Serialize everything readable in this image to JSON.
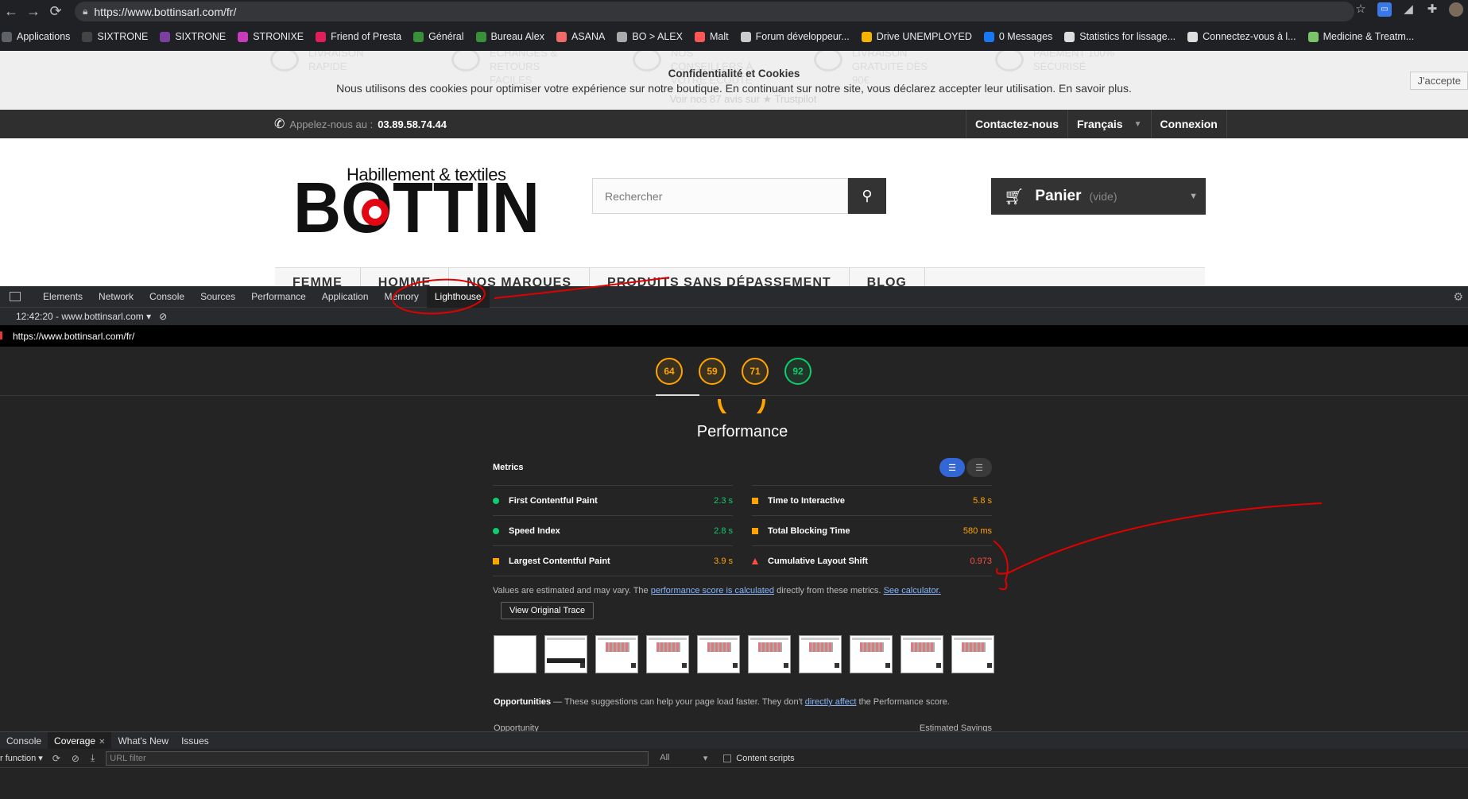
{
  "browser": {
    "url": "https://www.bottinsarl.com/fr/",
    "bookmarks": [
      {
        "label": "Applications",
        "color": "#5f6368"
      },
      {
        "label": "SIXTRONE",
        "color": "#444"
      },
      {
        "label": "SIXTRONE",
        "color": "#7b3fa0"
      },
      {
        "label": "STRONIXE",
        "color": "#c83cb9"
      },
      {
        "label": "Friend of Presta",
        "color": "#e01e5a"
      },
      {
        "label": "Général",
        "color": "#3a8f3a"
      },
      {
        "label": "Bureau Alex",
        "color": "#3a8f3a"
      },
      {
        "label": "ASANA",
        "color": "#f06a6a"
      },
      {
        "label": "BO > ALEX",
        "color": "#aaa"
      },
      {
        "label": "Malt",
        "color": "#fc5757"
      },
      {
        "label": "Forum développeur...",
        "color": "#ccc"
      },
      {
        "label": "Drive UNEMPLOYED",
        "color": "#f4b400"
      },
      {
        "label": "0 Messages",
        "color": "#1877f2"
      },
      {
        "label": "Statistics for lissage...",
        "color": "#ddd"
      },
      {
        "label": "Connectez-vous à l...",
        "color": "#ddd"
      },
      {
        "label": "Medicine & Treatm...",
        "color": "#7cc46a"
      }
    ]
  },
  "site": {
    "reassurance": [
      {
        "label": "LIVRAISON RAPIDE"
      },
      {
        "label": "ÉCHANGES & RETOURS FACILES"
      },
      {
        "label": "NOS CONSEILLERS À VOTRE ÉCOUTE"
      },
      {
        "label": "LIVRAISON GRATUITE DÈS 90€"
      },
      {
        "label": "PAIEMENT 100% SÉCURISÉ"
      }
    ],
    "cookie": {
      "title": "Confidentialité et Cookies",
      "text": "Nous utilisons des cookies pour optimiser votre expérience sur notre boutique. En continuant sur notre site, vous déclarez accepter leur utilisation. En savoir plus.",
      "accept": "J'accepte",
      "trustpilot": "Voir nos 87 avis sur  ★ Trustpilot"
    },
    "phone_label": "Appelez-nous au :",
    "phone_number": "03.89.58.74.44",
    "topnav": {
      "contact": "Contactez-nous",
      "language": "Français",
      "login": "Connexion"
    },
    "logo": {
      "tagline": "Habillement & textiles",
      "name": "BOTTIN"
    },
    "search_placeholder": "Rechercher",
    "cart": {
      "label": "Panier",
      "state": "(vide)"
    },
    "menu": [
      "FEMME",
      "HOMME",
      "NOS MARQUES",
      "PRODUITS SANS DÉPASSEMENT",
      "BLOG"
    ]
  },
  "devtools": {
    "tabs": [
      "Elements",
      "Network",
      "Console",
      "Sources",
      "Performance",
      "Application",
      "Memory",
      "Lighthouse"
    ],
    "active_tab": "Lighthouse",
    "report_select": "12:42:20 - www.bottinsarl.com",
    "report_url": "https://www.bottinsarl.com/fr/",
    "gauges": [
      {
        "score": "64",
        "color": "orange"
      },
      {
        "score": "59",
        "color": "orange"
      },
      {
        "score": "71",
        "color": "orange"
      },
      {
        "score": "92",
        "color": "green"
      }
    ],
    "category_title": "Performance",
    "metrics_title": "Metrics",
    "metrics": [
      {
        "name": "First Contentful Paint",
        "value": "2.3 s",
        "status": "green"
      },
      {
        "name": "Time to Interactive",
        "value": "5.8 s",
        "status": "orange"
      },
      {
        "name": "Speed Index",
        "value": "2.8 s",
        "status": "green"
      },
      {
        "name": "Total Blocking Time",
        "value": "580 ms",
        "status": "orange"
      },
      {
        "name": "Largest Contentful Paint",
        "value": "3.9 s",
        "status": "orange"
      },
      {
        "name": "Cumulative Layout Shift",
        "value": "0.973",
        "status": "red"
      }
    ],
    "note_prefix": "Values are estimated and may vary. The ",
    "note_link1": "performance score is calculated",
    "note_middle": " directly from these metrics. ",
    "note_link2": "See calculator.",
    "trace_button": "View Original Trace",
    "opportunities_title": "Opportunities",
    "opportunities_text": " — These suggestions can help your page load faster. They don't ",
    "opportunities_link": "directly affect",
    "opportunities_tail": " the Performance score.",
    "opp_col1": "Opportunity",
    "opp_col2": "Estimated Savings",
    "drawer_tabs": [
      "Console",
      "Coverage",
      "What's New",
      "Issues"
    ],
    "coverage": {
      "mode": "r function",
      "url_filter_placeholder": "URL filter",
      "type": "All",
      "content_scripts": "Content scripts"
    }
  },
  "colors": {
    "annotation_red": "#e00000",
    "lh_orange": "#ffa400",
    "lh_green": "#0cce6b",
    "lh_red": "#ff4e42"
  }
}
